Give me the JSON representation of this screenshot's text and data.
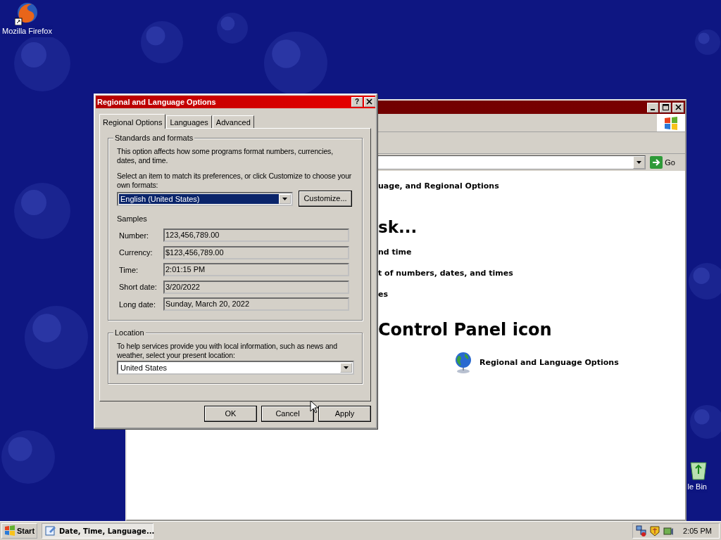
{
  "desktop": {
    "icons": [
      {
        "kind": "firefox",
        "label": "Mozilla Firefox"
      },
      {
        "kind": "bin",
        "label": "le Bin"
      }
    ]
  },
  "background_window": {
    "go_button": "Go",
    "texts": [
      {
        "kind": "subtitle",
        "text": "uage, and Regional Options"
      },
      {
        "kind": "heading",
        "text": "sk..."
      },
      {
        "kind": "task",
        "text": "nd time"
      },
      {
        "kind": "task",
        "text": "t of numbers, dates, and times"
      },
      {
        "kind": "task",
        "text": "es"
      },
      {
        "kind": "heading",
        "text": "Control Panel icon"
      },
      {
        "kind": "icon_link",
        "text": "Regional and Language Options"
      }
    ]
  },
  "dialog": {
    "title": "Regional and Language Options",
    "help_button": "?",
    "tabs": [
      {
        "label": "Regional Options",
        "selected": true
      },
      {
        "label": "Languages",
        "selected": false
      },
      {
        "label": "Advanced",
        "selected": false
      }
    ],
    "standards": {
      "legend": "Standards and formats",
      "description": "This option affects how some programs format numbers, currencies, dates, and time.",
      "instruction": "Select an item to match its preferences, or click Customize to choose your own formats:",
      "format": {
        "value": "English (United States)",
        "focused": true
      },
      "customize_button": "Customize...",
      "samples_label": "Samples",
      "samples": [
        {
          "label": "Number:",
          "value": "123,456,789.00"
        },
        {
          "label": "Currency:",
          "value": "$123,456,789.00"
        },
        {
          "label": "Time:",
          "value": "2:01:15 PM"
        },
        {
          "label": "Short date:",
          "value": "3/20/2022"
        },
        {
          "label": "Long date:",
          "value": "Sunday, March 20, 2022"
        }
      ]
    },
    "location": {
      "legend": "Location",
      "description": "To help services provide you with local information, such as news and weather, select your present location:",
      "value": "United States"
    },
    "buttons": [
      "OK",
      "Cancel",
      "Apply"
    ]
  },
  "taskbar": {
    "start_button": "Start",
    "tasks": [
      {
        "label": "Date, Time, Language...",
        "selected": true
      }
    ],
    "clock": "2:05 PM"
  }
}
